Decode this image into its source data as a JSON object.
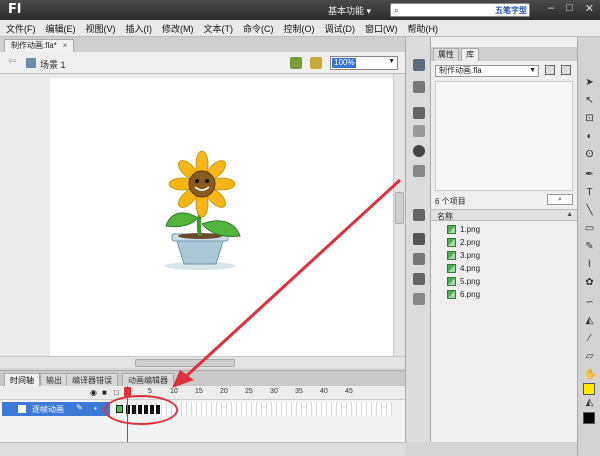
{
  "app": {
    "logo": "Fl",
    "workspace": "基本功能 ▾",
    "search_icon": "⌕",
    "watermark": "五笔字型"
  },
  "window_controls": {
    "minimize": "–",
    "maximize": "□",
    "close": "✕"
  },
  "menu": [
    "文件(F)",
    "编辑(E)",
    "视图(V)",
    "插入(I)",
    "修改(M)",
    "文本(T)",
    "命令(C)",
    "控制(O)",
    "调试(D)",
    "窗口(W)",
    "帮助(H)"
  ],
  "document_tab": {
    "title": "制作动画.fla*",
    "close": "×"
  },
  "scene": {
    "label": "场景 1",
    "zoom": "100%"
  },
  "bottom_tabs": [
    "时间轴",
    "输出",
    "编译器错误",
    "动画编辑器"
  ],
  "timeline": {
    "frame_numbers": [
      "5",
      "10",
      "15",
      "20",
      "25",
      "30",
      "35",
      "40",
      "45"
    ],
    "layer_name": "逐帧动画",
    "current_frame": 1,
    "keyframes": 6
  },
  "right_panel": {
    "tabs": [
      "属性",
      "库"
    ],
    "library_file": "制作动画.fla",
    "item_count": "6 个项目",
    "column_name": "名称",
    "items": [
      "1.png",
      "2.png",
      "3.png",
      "4.png",
      "5.png",
      "6.png"
    ]
  },
  "colors": {
    "accent": "#3875d7",
    "annotation": "#e0303c",
    "keyframe_green": "#35c54b"
  }
}
